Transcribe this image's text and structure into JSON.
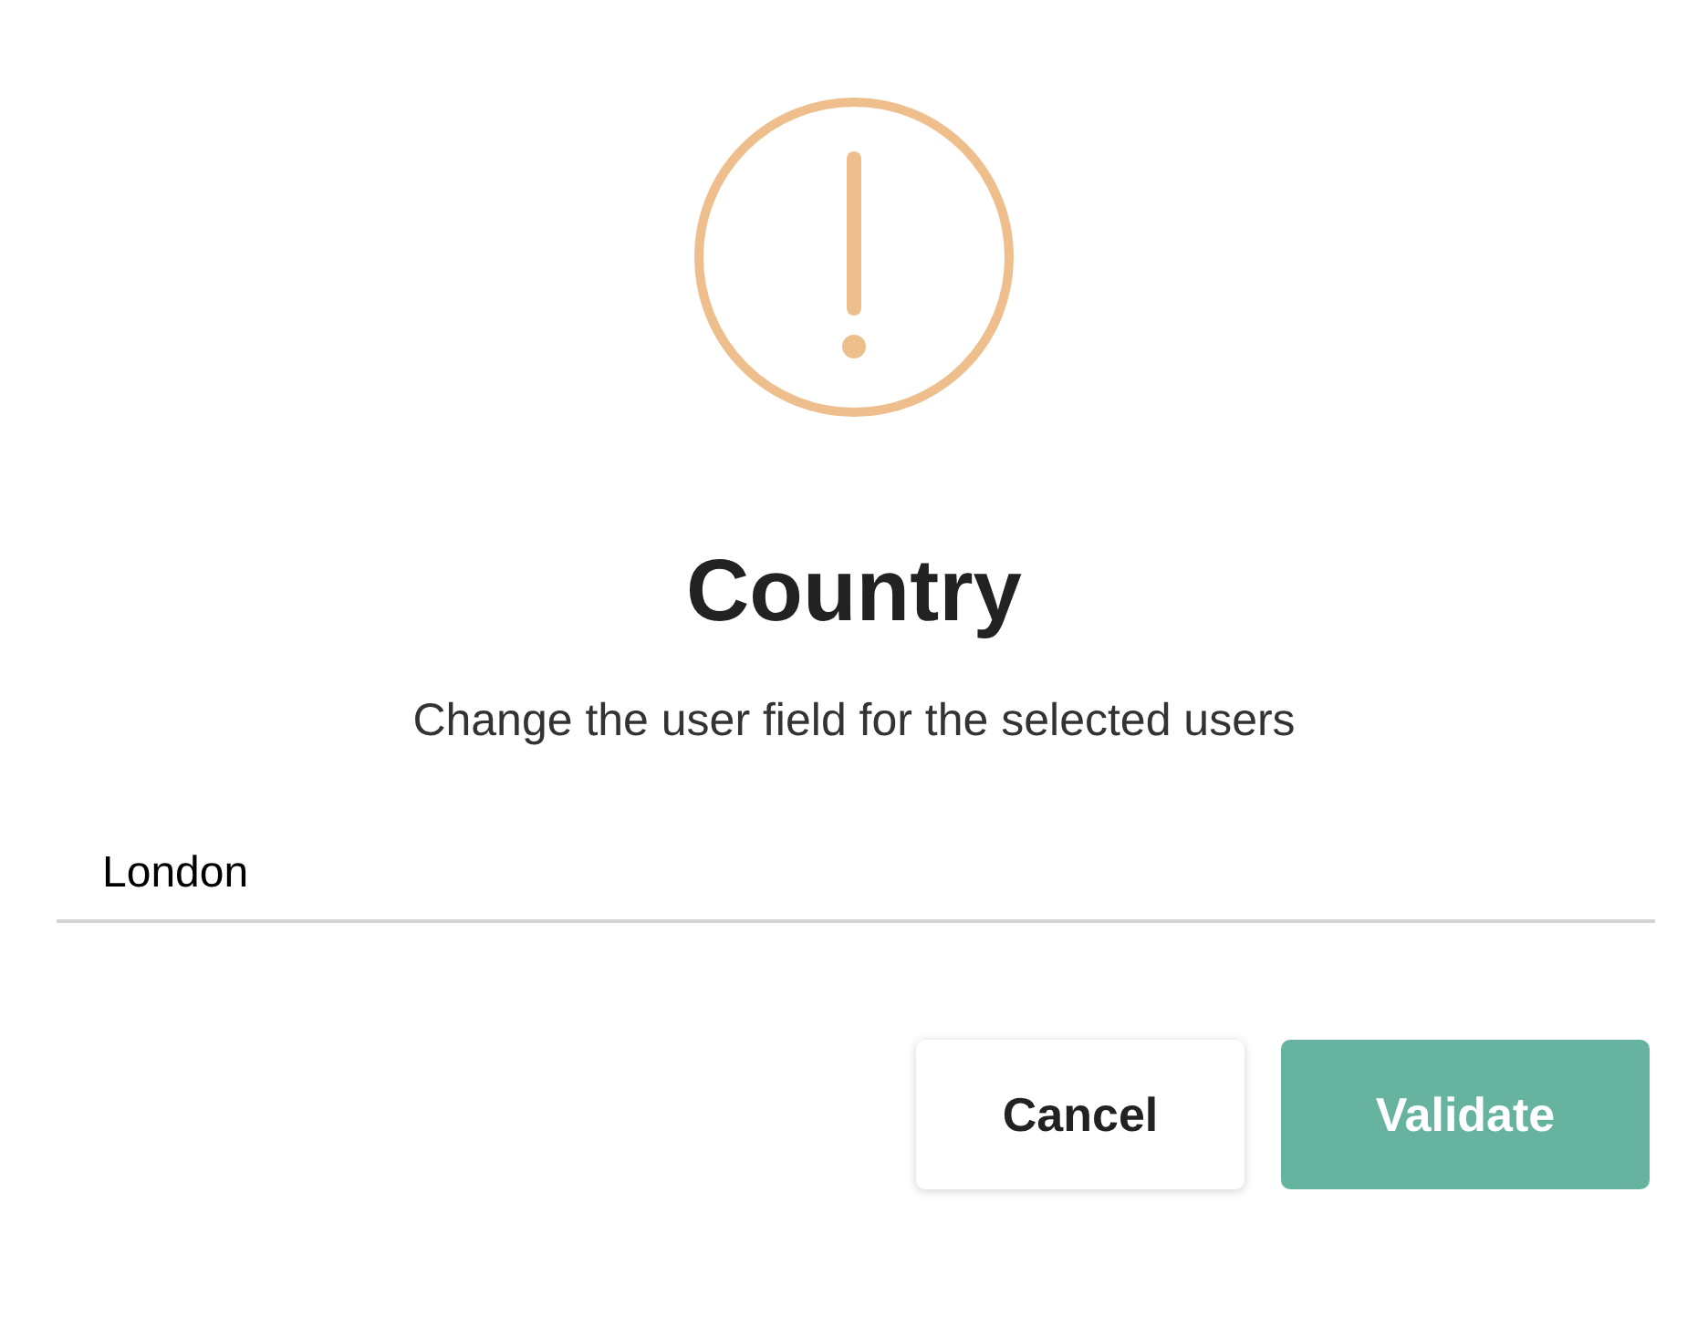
{
  "dialog": {
    "title": "Country",
    "message": "Change the user field for the selected users",
    "field": {
      "value": "London"
    },
    "buttons": [
      {
        "label": "Cancel",
        "kind": "secondary"
      },
      {
        "label": "Validate",
        "kind": "primary"
      }
    ]
  }
}
